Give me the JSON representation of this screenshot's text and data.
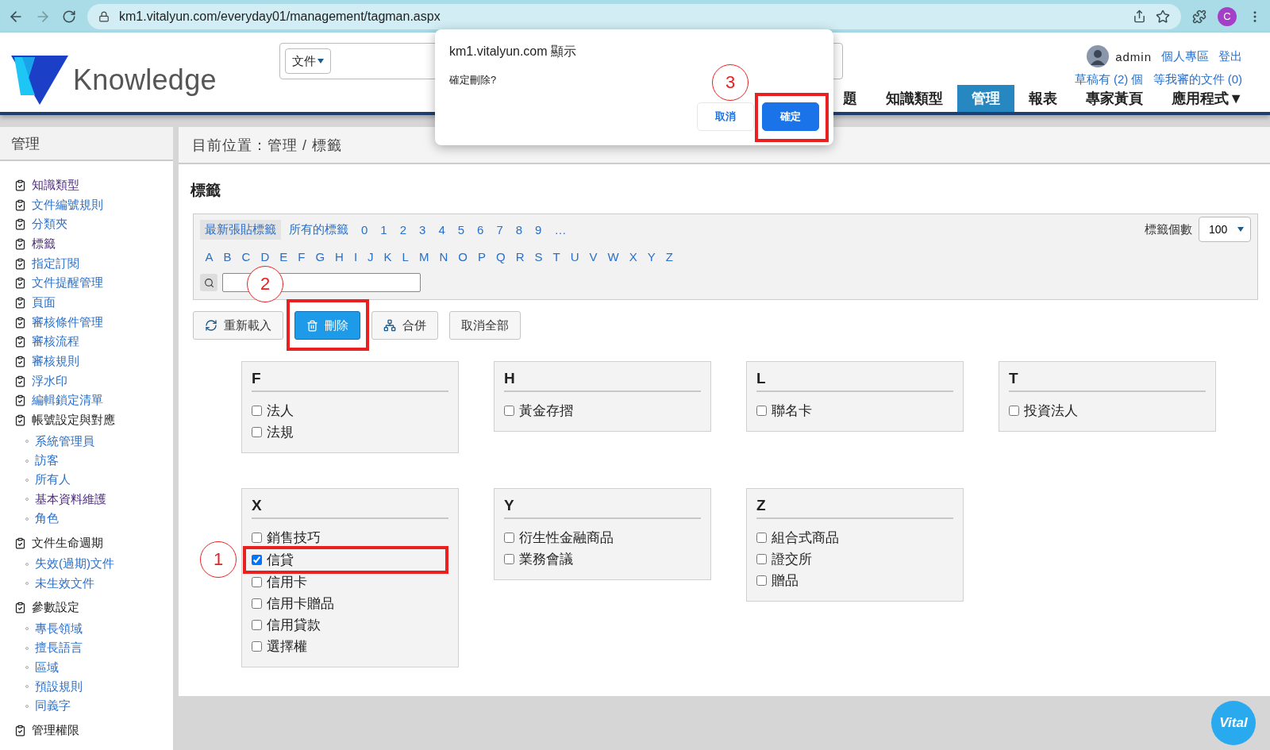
{
  "browser": {
    "url": "km1.vitalyun.com/everyday01/management/tagman.aspx",
    "profile_initial": "C"
  },
  "header": {
    "logo_text": "Knowledge",
    "search_scope": "文件",
    "user": "admin",
    "user_links": [
      "個人專區",
      "登出"
    ],
    "status_links": [
      "草稿有 (2) 個",
      "等我審的文件 (0)"
    ],
    "nav": [
      {
        "label": "題",
        "selected": false
      },
      {
        "label": "知識類型",
        "selected": false
      },
      {
        "label": "管理",
        "selected": true
      },
      {
        "label": "報表",
        "selected": false
      },
      {
        "label": "專家黃頁",
        "selected": false
      },
      {
        "label": "應用程式▼",
        "selected": false
      }
    ]
  },
  "sidebar": {
    "title": "管理",
    "items": [
      {
        "label": "知識類型",
        "kind": "link",
        "visited": true
      },
      {
        "label": "文件編號規則",
        "kind": "link",
        "visited": false
      },
      {
        "label": "分類夾",
        "kind": "link",
        "visited": false
      },
      {
        "label": "標籤",
        "kind": "link",
        "visited": true
      },
      {
        "label": "指定訂閱",
        "kind": "link",
        "visited": false
      },
      {
        "label": "文件提醒管理",
        "kind": "link",
        "visited": false
      },
      {
        "label": "頁面",
        "kind": "link",
        "visited": false
      },
      {
        "label": "審核條件管理",
        "kind": "link",
        "visited": false
      },
      {
        "label": "審核流程",
        "kind": "link",
        "visited": false
      },
      {
        "label": "審核規則",
        "kind": "link",
        "visited": false
      },
      {
        "label": "浮水印",
        "kind": "link",
        "visited": false
      },
      {
        "label": "編輯鎖定清單",
        "kind": "link",
        "visited": false
      },
      {
        "label": "帳號設定與對應",
        "kind": "group",
        "children": [
          {
            "label": "系統管理員",
            "visited": false
          },
          {
            "label": "訪客",
            "visited": false
          },
          {
            "label": "所有人",
            "visited": false
          },
          {
            "label": "基本資料維護",
            "visited": true
          },
          {
            "label": "角色",
            "visited": false
          }
        ]
      },
      {
        "label": "文件生命週期",
        "kind": "group",
        "children": [
          {
            "label": "失效(過期)文件",
            "visited": false
          },
          {
            "label": "未生效文件",
            "visited": false
          }
        ]
      },
      {
        "label": "參數設定",
        "kind": "group",
        "children": [
          {
            "label": "專長領域",
            "visited": false
          },
          {
            "label": "擅長語言",
            "visited": false
          },
          {
            "label": "區域",
            "visited": false
          },
          {
            "label": "預設規則",
            "visited": false
          },
          {
            "label": "同義字",
            "visited": false
          }
        ]
      },
      {
        "label": "管理權限",
        "kind": "group"
      }
    ]
  },
  "breadcrumb": "目前位置：管理 / 標籤",
  "page_title": "標籤",
  "filter": {
    "quick_links": [
      {
        "label": "最新張貼標籤",
        "selected": true
      },
      {
        "label": "所有的標籤",
        "selected": false
      },
      {
        "label": "0",
        "selected": false
      },
      {
        "label": "1",
        "selected": false
      },
      {
        "label": "2",
        "selected": false
      },
      {
        "label": "3",
        "selected": false
      },
      {
        "label": "4",
        "selected": false
      },
      {
        "label": "5",
        "selected": false
      },
      {
        "label": "6",
        "selected": false
      },
      {
        "label": "7",
        "selected": false
      },
      {
        "label": "8",
        "selected": false
      },
      {
        "label": "9",
        "selected": false
      },
      {
        "label": "…",
        "selected": false
      }
    ],
    "letters": [
      {
        "label": "A",
        "selected": false
      },
      {
        "label": "B",
        "selected": false
      },
      {
        "label": "C",
        "selected": false
      },
      {
        "label": "D",
        "selected": false
      },
      {
        "label": "E",
        "selected": false
      },
      {
        "label": "F",
        "selected": false
      },
      {
        "label": "G",
        "selected": false
      },
      {
        "label": "H",
        "selected": false
      },
      {
        "label": "I",
        "selected": false
      },
      {
        "label": "J",
        "selected": false
      },
      {
        "label": "K",
        "selected": false
      },
      {
        "label": "L",
        "selected": false
      },
      {
        "label": "M",
        "selected": false
      },
      {
        "label": "N",
        "selected": false
      },
      {
        "label": "O",
        "selected": false
      },
      {
        "label": "P",
        "selected": false
      },
      {
        "label": "Q",
        "selected": false
      },
      {
        "label": "R",
        "selected": false
      },
      {
        "label": "S",
        "selected": false
      },
      {
        "label": "T",
        "selected": false
      },
      {
        "label": "U",
        "selected": false
      },
      {
        "label": "V",
        "selected": false
      },
      {
        "label": "W",
        "selected": false
      },
      {
        "label": "X",
        "selected": false
      },
      {
        "label": "Y",
        "selected": false
      },
      {
        "label": "Z",
        "selected": false
      }
    ],
    "count_label": "標籤個數",
    "count_value": "100"
  },
  "actions": [
    {
      "label": "重新載入",
      "kind": "reload"
    },
    {
      "label": "刪除",
      "kind": "delete",
      "annotation": "2"
    },
    {
      "label": "合併",
      "kind": "merge"
    },
    {
      "label": "取消全部",
      "kind": "plain"
    }
  ],
  "groups": [
    {
      "letter": "F",
      "tags": [
        {
          "label": "法人",
          "checked": false
        },
        {
          "label": "法規",
          "checked": false
        }
      ]
    },
    {
      "letter": "H",
      "tags": [
        {
          "label": "黃金存摺",
          "checked": false
        }
      ]
    },
    {
      "letter": "L",
      "tags": [
        {
          "label": "聯名卡",
          "checked": false
        }
      ]
    },
    {
      "letter": "T",
      "tags": [
        {
          "label": "投資法人",
          "checked": false
        }
      ]
    },
    {
      "letter": "X",
      "tags": [
        {
          "label": "銷售技巧",
          "checked": false
        },
        {
          "label": "信貸",
          "checked": true,
          "annotation": "1"
        },
        {
          "label": "信用卡",
          "checked": false
        },
        {
          "label": "信用卡贈品",
          "checked": false
        },
        {
          "label": "信用貸款",
          "checked": false
        },
        {
          "label": "選擇權",
          "checked": false
        }
      ]
    },
    {
      "letter": "Y",
      "tags": [
        {
          "label": "衍生性金融商品",
          "checked": false
        },
        {
          "label": "業務會議",
          "checked": false
        }
      ]
    },
    {
      "letter": "Z",
      "tags": [
        {
          "label": "組合式商品",
          "checked": false
        },
        {
          "label": "證交所",
          "checked": false
        },
        {
          "label": "贈品",
          "checked": false
        }
      ]
    }
  ],
  "dialog": {
    "origin": "km1.vitalyun.com 顯示",
    "message": "確定刪除?",
    "buttons": [
      {
        "label": "取消",
        "kind": "secondary"
      },
      {
        "label": "確定",
        "kind": "primary",
        "annotation": "3"
      }
    ]
  },
  "chat_badge": "Vital"
}
